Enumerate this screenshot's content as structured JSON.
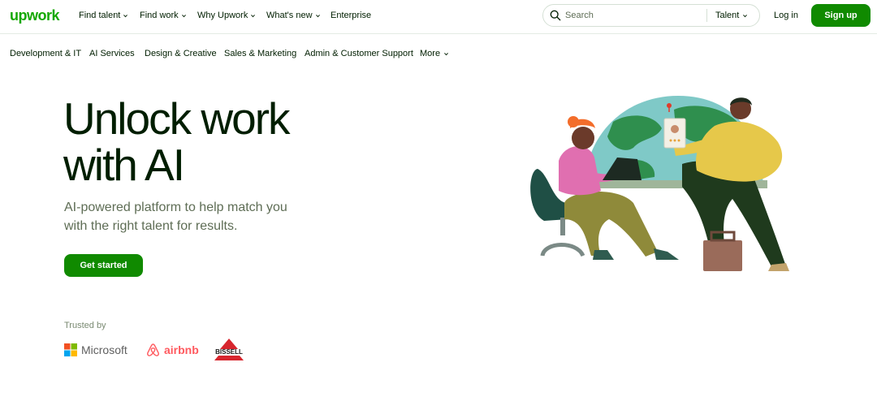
{
  "header": {
    "logo": "upwork",
    "nav": [
      {
        "label": "Find talent",
        "dropdown": true
      },
      {
        "label": "Find work",
        "dropdown": true
      },
      {
        "label": "Why Upwork",
        "dropdown": true
      },
      {
        "label": "What's new",
        "dropdown": true
      },
      {
        "label": "Enterprise",
        "dropdown": false
      }
    ],
    "search": {
      "placeholder": "Search",
      "value": "",
      "scope": "Talent"
    },
    "login_label": "Log in",
    "signup_label": "Sign up"
  },
  "categories": [
    {
      "label": "Development & IT"
    },
    {
      "label": "AI Services"
    },
    {
      "label": "Design & Creative"
    },
    {
      "label": "Sales & Marketing"
    },
    {
      "label": "Admin & Customer Support"
    },
    {
      "label": "More",
      "dropdown": true
    }
  ],
  "hero": {
    "title_line1": "Unlock work",
    "title_line2": "with AI",
    "subtitle_line1": "AI-powered platform to help match you",
    "subtitle_line2": "with the right talent for results.",
    "cta_label": "Get started"
  },
  "trusted": {
    "label": "Trusted by",
    "brands": [
      "Microsoft",
      "airbnb",
      "BISSELL"
    ]
  },
  "colors": {
    "brand_green": "#14a800",
    "button_green": "#108a00",
    "text_dark": "#001e00",
    "text_muted": "#5e6d55"
  }
}
